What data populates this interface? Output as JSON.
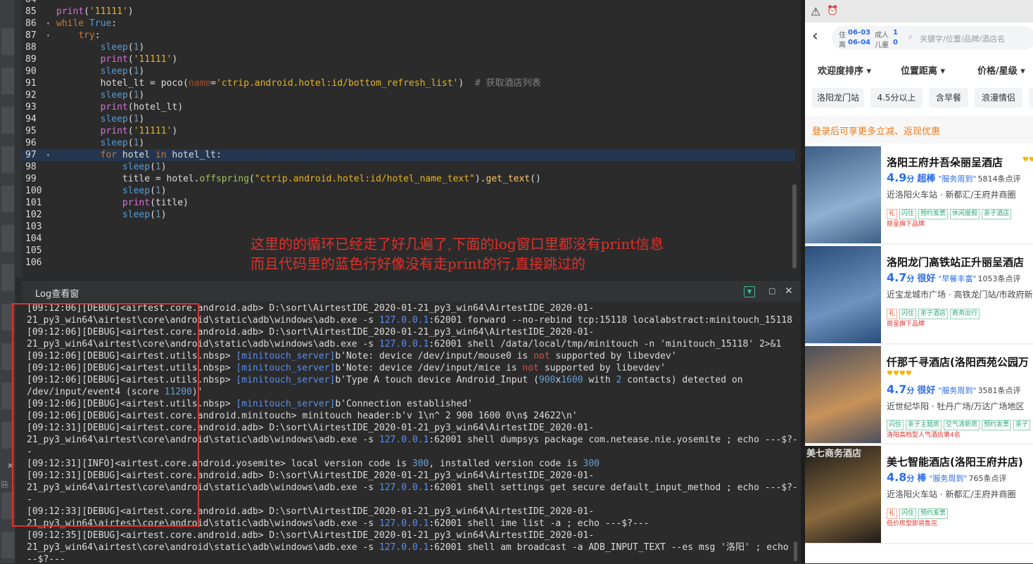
{
  "editor": {
    "lines": [
      {
        "n": "84",
        "fold": "",
        "html": ""
      },
      {
        "n": "85",
        "fold": "",
        "html": "<span class=\"fn\">print</span>(<span class=\"str\">'11111'</span>)"
      },
      {
        "n": "86",
        "fold": "▾",
        "html": "<span class=\"kw\">while</span> <span class=\"kw2\">True</span>:"
      },
      {
        "n": "87",
        "fold": "▾",
        "html": "    <span class=\"kw\">try</span>:"
      },
      {
        "n": "88",
        "fold": "",
        "html": "        <span class=\"kw2\">sleep</span>(<span class=\"num\">1</span>)"
      },
      {
        "n": "89",
        "fold": "",
        "html": "        <span class=\"fn\">print</span>(<span class=\"str\">'11111'</span>)"
      },
      {
        "n": "90",
        "fold": "",
        "html": "        <span class=\"kw2\">sleep</span>(<span class=\"num\">1</span>)"
      },
      {
        "n": "91",
        "fold": "",
        "html": "        hotel_lt = poco(<span class=\"param\">name</span>=<span class=\"str\">'ctrip.android.hotel:id/bottom_refresh_list'</span>)  <span class=\"cmt\"># 获取酒店列表</span>"
      },
      {
        "n": "92",
        "fold": "",
        "html": "        <span class=\"kw2\">sleep</span>(<span class=\"num\">1</span>)"
      },
      {
        "n": "93",
        "fold": "",
        "html": "        <span class=\"fn\">print</span>(hotel_lt)"
      },
      {
        "n": "94",
        "fold": "",
        "html": "        <span class=\"kw2\">sleep</span>(<span class=\"num\">1</span>)"
      },
      {
        "n": "95",
        "fold": "",
        "html": "        <span class=\"fn\">print</span>(<span class=\"str\">'11111'</span>)"
      },
      {
        "n": "96",
        "fold": "",
        "html": "        <span class=\"kw2\">sleep</span>(<span class=\"num\">1</span>)"
      },
      {
        "n": "97",
        "fold": "▾",
        "html": "        <span class=\"kw\">for</span> hotel <span class=\"kw\">in</span> hotel_lt:",
        "hl": true
      },
      {
        "n": "98",
        "fold": "",
        "html": "            <span class=\"kw2\">sleep</span>(<span class=\"num\">1</span>)"
      },
      {
        "n": "99",
        "fold": "",
        "html": "            title = hotel.<span class=\"str2\">offspring</span>(<span class=\"str\">\"ctrip.android.hotel:id/hotel_name_text\"</span>).<span class=\"method\">get_text</span>()"
      },
      {
        "n": "100",
        "fold": "",
        "html": "            <span class=\"kw2\">sleep</span>(<span class=\"num\">1</span>)"
      },
      {
        "n": "101",
        "fold": "",
        "html": "            <span class=\"fn\">print</span>(title)"
      },
      {
        "n": "102",
        "fold": "",
        "html": "            <span class=\"kw2\">sleep</span>(<span class=\"num\">1</span>)"
      },
      {
        "n": "103",
        "fold": "",
        "html": ""
      },
      {
        "n": "104",
        "fold": "",
        "html": ""
      },
      {
        "n": "105",
        "fold": "",
        "html": ""
      },
      {
        "n": "106",
        "fold": "",
        "html": ""
      }
    ],
    "annotation_line1": "这里的的循环已经走了好几遍了,下面的log窗口里都没有print信息",
    "annotation_line2": "而且代码里的蓝色行好像没有走print的行,直接跳过的"
  },
  "log": {
    "title": "Log查看窗",
    "filter_icon": "filter-icon",
    "lines": [
      "[09:12:06][DEBUG]&lt;airtest.core.android.adb&gt; D:\\sort\\AirtestIDE_2020-01-21_py3_win64\\AirtestIDE_2020-01-",
      "21_py3_win64\\airtest\\core\\android\\static\\adb\\windows\\adb.exe -s <span class=\"lb\">127.0.0.1</span>:62001 forward --no-rebind tcp:15118 localabstract:minitouch_15118",
      "[09:12:06][DEBUG]&lt;airtest.core.android.adb&gt; D:\\sort\\AirtestIDE_2020-01-21_py3_win64\\AirtestIDE_2020-01-",
      "21_py3_win64\\airtest\\core\\android\\static\\adb\\windows\\adb.exe -s <span class=\"lb\">127.0.0.1</span>:62001 shell /data/local/tmp/minitouch -n 'minitouch_15118' 2&gt;&amp;1",
      "[09:12:06][DEBUG]&lt;airtest.utils.nbsp&gt; <span class=\"lb\">[minitouch_server]</span>b'Note: device /dev/input/mouse0 is <span class=\"lr\">not</span> supported by libevdev'",
      "[09:12:06][DEBUG]&lt;airtest.utils.nbsp&gt; <span class=\"lb\">[minitouch_server]</span>b'Note: device /dev/input/mice is <span class=\"lr\">not</span> supported by libevdev'",
      "[09:12:06][DEBUG]&lt;airtest.utils.nbsp&gt; <span class=\"lb\">[minitouch_server]</span>b'Type A touch device Android_Input (<span class=\"lm\">900</span>x<span class=\"lm\">1600</span> with <span class=\"lm\">2</span> contacts) detected on",
      "/dev/input/event4 (score <span class=\"lm\">11200</span>)'",
      "[09:12:06][DEBUG]&lt;airtest.utils.nbsp&gt; <span class=\"lb\">[minitouch_server]</span>b'Connection established'",
      "[09:12:06][DEBUG]&lt;airtest.core.android.minitouch&gt; minitouch header:b'v 1\\n^ 2 900 1600 0\\n$ 24622\\n'",
      "[09:12:31][DEBUG]&lt;airtest.core.android.adb&gt; D:\\sort\\AirtestIDE_2020-01-21_py3_win64\\AirtestIDE_2020-01-",
      "21_py3_win64\\airtest\\core\\android\\static\\adb\\windows\\adb.exe -s <span class=\"lb\">127.0.0.1</span>:62001 shell dumpsys package com.netease.nie.yosemite ; echo ---$?--",
      "-",
      "[09:12:31][INFO]&lt;airtest.core.android.yosemite&gt; local version code is <span class=\"lm\">300</span>, installed version code is <span class=\"lm\">300</span>",
      "[09:12:31][DEBUG]&lt;airtest.core.android.adb&gt; D:\\sort\\AirtestIDE_2020-01-21_py3_win64\\AirtestIDE_2020-01-",
      "21_py3_win64\\airtest\\core\\android\\static\\adb\\windows\\adb.exe -s <span class=\"lb\">127.0.0.1</span>:62001 shell settings get secure default_input_method ; echo ---$?--",
      "-",
      "[09:12:33][DEBUG]&lt;airtest.core.android.adb&gt; D:\\sort\\AirtestIDE_2020-01-21_py3_win64\\AirtestIDE_2020-01-",
      "21_py3_win64\\airtest\\core\\android\\static\\adb\\windows\\adb.exe -s <span class=\"lb\">127.0.0.1</span>:62001 shell ime list -a ; echo ---$?---",
      "[09:12:35][DEBUG]&lt;airtest.core.android.adb&gt; D:\\sort\\AirtestIDE_2020-01-21_py3_win64\\AirtestIDE_2020-01-",
      "21_py3_win64\\airtest\\core\\android\\static\\adb\\windows\\adb.exe -s <span class=\"lb\">127.0.0.1</span>:62001 shell am broadcast -a ADB_INPUT_TEXT --es msg '洛阳' ; echo -",
      "--$?---"
    ]
  },
  "side": {
    "glyph1": "✕",
    "glyph2": "⎘"
  },
  "phone": {
    "status": {
      "warn_icon": "warning-icon",
      "alarm_icon": "alarm-icon"
    },
    "search": {
      "checkin_label": "住",
      "checkin_date": "06-03",
      "checkout_label": "离",
      "checkout_date": "06-04",
      "adult_label": "成人",
      "adult_count": "1",
      "child_label": "儿童",
      "child_count": "0",
      "placeholder": "关键字/位置/品牌/酒店名"
    },
    "sort": [
      "欢迎度排序 ▾",
      "位置距离 ▾",
      "价格/星级 ▾"
    ],
    "chips": [
      "洛阳龙门站",
      "4.5分以上",
      "含早餐",
      "浪漫情侣",
      "多"
    ],
    "promo": "登录后可享更多立减、返现优惠",
    "hotels": [
      {
        "name": "洛阳王府井吾朵丽呈酒店",
        "stars": "♥♥♥",
        "score": "4.9",
        "unit": "分",
        "level": "超棒",
        "quote": "\"服务周到\"",
        "reviews": "5814条点评",
        "location": "近洛阳火车站 · 新都汇/王府井商圈",
        "tags": [
          "礼",
          "闪住",
          "预约发票",
          "休闲度假",
          "亲子酒店"
        ],
        "promo": "丽呈旗下品牌",
        "colors": [
          "#3e5f86",
          "#8fb0cf"
        ]
      },
      {
        "name": "洛阳龙门高铁站正升丽呈酒店",
        "stars": "",
        "score": "4.7",
        "unit": "分",
        "level": "很好",
        "quote": "\"早餐丰富\"",
        "reviews": "1053条点评",
        "location": "近宝龙城市广场 · 高铁龙门站/市政府新",
        "tags": [
          "礼",
          "闪住",
          "亲子酒店",
          "商务出行"
        ],
        "promo": "丽呈旗下品牌",
        "colors": [
          "#2a4d7a",
          "#6f93c0"
        ]
      },
      {
        "name": "仟那千寻酒店(洛阳西苑公园万",
        "stars": "♥♥♥♥",
        "score": "4.7",
        "unit": "分",
        "level": "很好",
        "quote": "\"服务周到\"",
        "reviews": "3581条点评",
        "location": "近世纪华阳 · 牡丹广场/万达广场地区",
        "tags": [
          "闪住",
          "亲子主题房",
          "空气清新房",
          "预约发票",
          "亲子"
        ],
        "promo": "洛阳高档型人气酒店第4名",
        "colors": [
          "#4a4f5c",
          "#c8925a"
        ]
      },
      {
        "name": "美七智能酒店(洛阳王府井店)",
        "stars": "",
        "score": "4.8",
        "unit": "分",
        "level": "棒",
        "quote": "\"服务周到\"",
        "reviews": "765条点评",
        "location": "近洛阳火车站 · 新都汇/王府井商圈",
        "tags": [
          "礼",
          "闪住",
          "预约发票"
        ],
        "promo": "低价房型即将售完",
        "sign": "美七商务酒店",
        "colors": [
          "#1c1a18",
          "#8a6a3e"
        ]
      }
    ]
  }
}
